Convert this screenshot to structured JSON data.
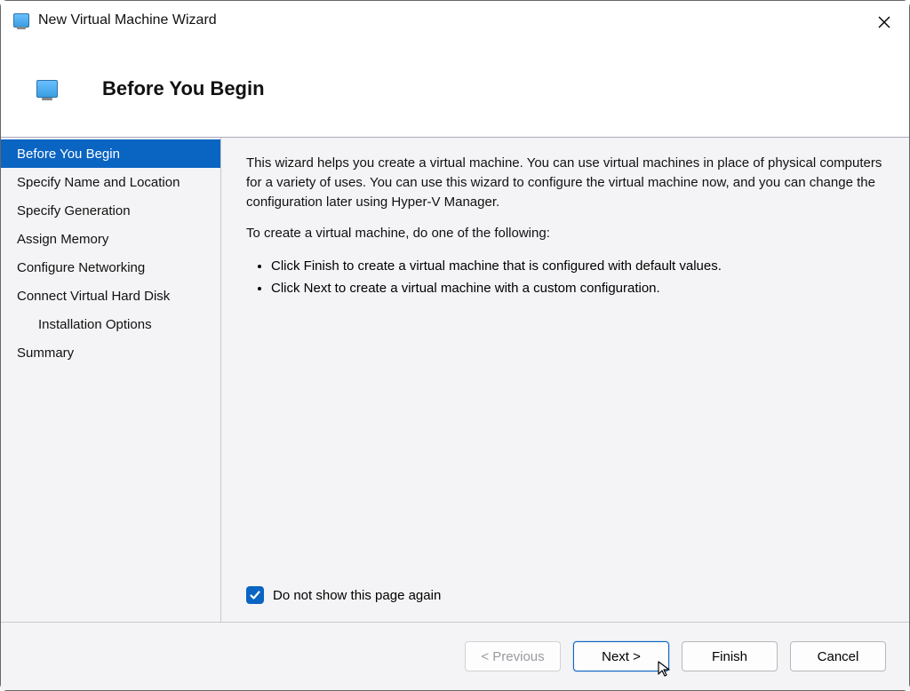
{
  "titlebar": {
    "title": "New Virtual Machine Wizard"
  },
  "header": {
    "title": "Before You Begin"
  },
  "sidebar": {
    "items": [
      {
        "label": "Before You Begin",
        "selected": true,
        "indent": false
      },
      {
        "label": "Specify Name and Location",
        "selected": false,
        "indent": false
      },
      {
        "label": "Specify Generation",
        "selected": false,
        "indent": false
      },
      {
        "label": "Assign Memory",
        "selected": false,
        "indent": false
      },
      {
        "label": "Configure Networking",
        "selected": false,
        "indent": false
      },
      {
        "label": "Connect Virtual Hard Disk",
        "selected": false,
        "indent": false
      },
      {
        "label": "Installation Options",
        "selected": false,
        "indent": true
      },
      {
        "label": "Summary",
        "selected": false,
        "indent": false
      }
    ]
  },
  "content": {
    "intro": "This wizard helps you create a virtual machine. You can use virtual machines in place of physical computers for a variety of uses. You can use this wizard to configure the virtual machine now, and you can change the configuration later using Hyper-V Manager.",
    "instruction": "To create a virtual machine, do one of the following:",
    "bullets": [
      "Click Finish to create a virtual machine that is configured with default values.",
      "Click Next to create a virtual machine with a custom configuration."
    ],
    "checkbox_label": "Do not show this page again",
    "checkbox_checked": true
  },
  "buttons": {
    "previous": "< Previous",
    "next": "Next >",
    "finish": "Finish",
    "cancel": "Cancel"
  }
}
